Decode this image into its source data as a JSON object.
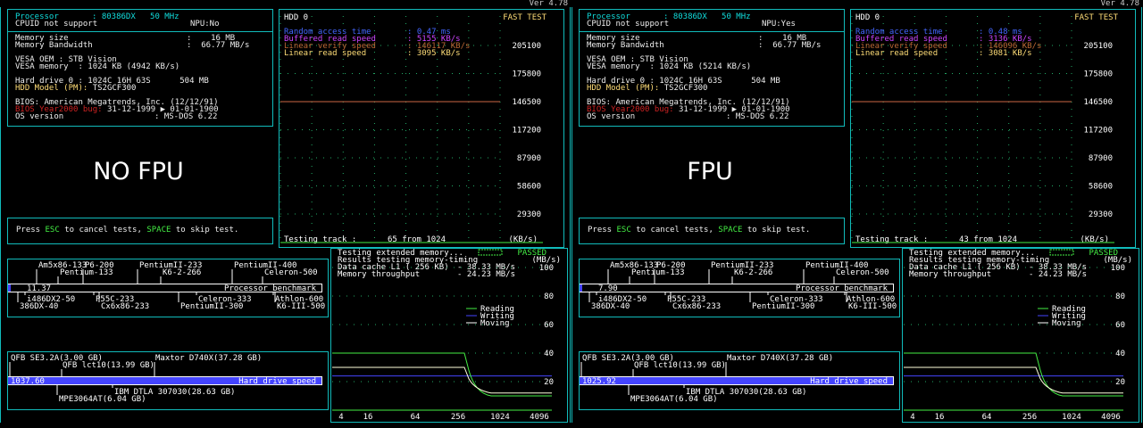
{
  "version": "Ver 4.78",
  "screens": [
    {
      "cpu": {
        "processor_label": "Processor",
        "processor_value": ": 80386DX   50 MHz",
        "cpuid": "CPUID not support",
        "npu": "NPU:No",
        "mem_size_label": "Memory size",
        "mem_size_value": ":    16 MB",
        "mem_bw_label": "Memory Bandwidth",
        "mem_bw_value": ":  66.77 MB/s",
        "vesa_oem": "VESA OEM : STB Vision",
        "vesa_mem": "VESA memory  : 1024 KB (4942 KB/s)",
        "hdd_label": "Hard drive 0 :",
        "hdd_value": "1024C 16H 63S      504 MB",
        "hdd_model_label": "HDD Model (PM):",
        "hdd_model_value": "TS2GCF300",
        "bios": "BIOS: American Megatrends, Inc. (12/12/91)",
        "y2k_label": "BIOS Year2000 bug:",
        "y2k_value": "31-12-1999 ▶ 01-01-1900",
        "os_label": "OS version",
        "os_value": ": MS-DOS 6.22"
      },
      "big_label": "NO FPU",
      "esc_prefix": "Press ",
      "esc_key": "ESC",
      "esc_mid": " to cancel tests, ",
      "space_key": "SPACE",
      "esc_suffix": " to skip test.",
      "hdd": {
        "title": "HDD 0",
        "mode": "FAST TEST",
        "random_label": "Random access time",
        "random_value": ": 0.47 ms",
        "buffered_label": "Buffered read speed",
        "buffered_value": ": 5155 KB/s",
        "verify_label": "Linear verify speed",
        "verify_value": ": 146117 KB/s",
        "linear_label": "Linear read speed",
        "linear_value": ": 3095 KB/s",
        "track_label": "Testing track :",
        "track_value": "65 from    1024",
        "unit": "(KB/s)",
        "y_ticks": [
          "205100",
          "175800",
          "146500",
          "117200",
          "87900",
          "58600",
          "29300"
        ]
      },
      "cpu_bench": {
        "labels": [
          {
            "text": "Am5x86-133",
            "x": 33,
            "y": 4,
            "above": true
          },
          {
            "text": "P6-200",
            "x": 85,
            "y": 4,
            "above": true
          },
          {
            "text": "PentiumII-233",
            "x": 146,
            "y": 4,
            "above": true
          },
          {
            "text": "PentiumII-400",
            "x": 252,
            "y": 4,
            "above": true
          },
          {
            "text": "Pentium-133",
            "x": 57,
            "y": 12,
            "above": true
          },
          {
            "text": "K6-2-266",
            "x": 172,
            "y": 12,
            "above": true
          },
          {
            "text": "Celeron-500",
            "x": 286,
            "y": 12,
            "above": true
          },
          {
            "text": "i486DX2-50",
            "x": 20,
            "y": 42,
            "above": false
          },
          {
            "text": "P55C-233",
            "x": 97,
            "y": 42,
            "above": false
          },
          {
            "text": "Celeron-333",
            "x": 212,
            "y": 42,
            "above": false
          },
          {
            "text": "Athlon-600",
            "x": 298,
            "y": 42,
            "above": false
          },
          {
            "text": "386DX-40",
            "x": 12,
            "y": 50,
            "above": false
          },
          {
            "text": "Cx6x86-233",
            "x": 103,
            "y": 50,
            "above": false
          },
          {
            "text": "PentiumII-300",
            "x": 192,
            "y": 50,
            "above": false
          },
          {
            "text": "K6-III-500",
            "x": 300,
            "y": 50,
            "above": false
          }
        ],
        "value": "11.37",
        "title": "Processor benchmark",
        "fill_fraction": 0.008
      },
      "hdd_bench": {
        "top_labels": [
          {
            "text": "QFB SE3.2A(3.00 GB)",
            "x": 2,
            "y": 4
          },
          {
            "text": "Maxtor D740X(37.28 GB)",
            "x": 164,
            "y": 4
          },
          {
            "text": "QFB lct10(13.99 GB)",
            "x": 60,
            "y": 12
          }
        ],
        "bottom_labels": [
          {
            "text": "IBM DTLA 307030(28.63 GB)",
            "x": 118,
            "y": 42
          },
          {
            "text": "MPE3064AT(6.04 GB)",
            "x": 56,
            "y": 50
          }
        ],
        "value": "1037.60",
        "title": "Hard drive speed",
        "fill_fraction": 1.0
      },
      "mem": {
        "line1": "Testing extended memory...",
        "status": "PASSED",
        "line2": "Results testing memory-timing",
        "unit": "(MB/s)",
        "l1_label": "Data cache L1 ( 256 KB)",
        "l1_value": "-   38.33 MB/s",
        "tp_label": "Memory throughput",
        "tp_value": "-   24.23 MB/s",
        "legend": [
          "Reading",
          "Writing",
          "Moving"
        ],
        "y_ticks": [
          "100",
          "80",
          "60",
          "40",
          "20"
        ],
        "x_ticks": [
          "4",
          "16",
          "64",
          "256",
          "1024",
          "4096"
        ]
      }
    },
    {
      "cpu": {
        "processor_label": "Processor",
        "processor_value": ": 80386DX   50 MHz",
        "cpuid": "CPUID not support",
        "npu": "NPU:Yes",
        "mem_size_label": "Memory size",
        "mem_size_value": ":    16 MB",
        "mem_bw_label": "Memory Bandwidth",
        "mem_bw_value": ":  66.77 MB/s",
        "vesa_oem": "VESA OEM : STB Vision",
        "vesa_mem": "VESA memory  : 1024 KB (5214 KB/s)",
        "hdd_label": "Hard drive 0 :",
        "hdd_value": "1024C 16H 63S      504 MB",
        "hdd_model_label": "HDD Model (PM):",
        "hdd_model_value": "TS2GCF300",
        "bios": "BIOS: American Megatrends, Inc. (12/12/91)",
        "y2k_label": "BIOS Year2000 bug:",
        "y2k_value": "31-12-1999 ▶ 01-01-1900",
        "os_label": "OS version",
        "os_value": ": MS-DOS 6.22"
      },
      "big_label": "FPU",
      "esc_prefix": "Press ",
      "esc_key": "ESC",
      "esc_mid": " to cancel tests, ",
      "space_key": "SPACE",
      "esc_suffix": " to skip test.",
      "hdd": {
        "title": "HDD 0",
        "mode": "FAST TEST",
        "random_label": "Random access time",
        "random_value": ": 0.48 ms",
        "buffered_label": "Buffered read speed",
        "buffered_value": ": 3136 KB/s",
        "verify_label": "Linear verify speed",
        "verify_value": ": 146096 KB/s",
        "linear_label": "Linear read speed",
        "linear_value": ": 3081 KB/s",
        "track_label": "Testing track :",
        "track_value": "43 from    1024",
        "unit": "(KB/s)",
        "y_ticks": [
          "205100",
          "175800",
          "146500",
          "117200",
          "87900",
          "58600",
          "29300"
        ]
      },
      "cpu_bench": {
        "labels": [
          {
            "text": "Am5x86-133",
            "x": 33,
            "y": 4,
            "above": true
          },
          {
            "text": "P6-200",
            "x": 85,
            "y": 4,
            "above": true
          },
          {
            "text": "PentiumII-233",
            "x": 146,
            "y": 4,
            "above": true
          },
          {
            "text": "PentiumII-400",
            "x": 252,
            "y": 4,
            "above": true
          },
          {
            "text": "Pentium-133",
            "x": 57,
            "y": 12,
            "above": true
          },
          {
            "text": "K6-2-266",
            "x": 172,
            "y": 12,
            "above": true
          },
          {
            "text": "Celeron-500",
            "x": 286,
            "y": 12,
            "above": true
          },
          {
            "text": "i486DX2-50",
            "x": 20,
            "y": 42,
            "above": false
          },
          {
            "text": "P55C-233",
            "x": 97,
            "y": 42,
            "above": false
          },
          {
            "text": "Celeron-333",
            "x": 212,
            "y": 42,
            "above": false
          },
          {
            "text": "Athlon-600",
            "x": 298,
            "y": 42,
            "above": false
          },
          {
            "text": "386DX-40",
            "x": 12,
            "y": 50,
            "above": false
          },
          {
            "text": "Cx6x86-233",
            "x": 103,
            "y": 50,
            "above": false
          },
          {
            "text": "PentiumII-300",
            "x": 192,
            "y": 50,
            "above": false
          },
          {
            "text": "K6-III-500",
            "x": 300,
            "y": 50,
            "above": false
          }
        ],
        "value": "7.90",
        "title": "Processor benchmark",
        "fill_fraction": 0.006
      },
      "hdd_bench": {
        "top_labels": [
          {
            "text": "QFB SE3.2A(3.00 GB)",
            "x": 2,
            "y": 4
          },
          {
            "text": "Maxtor D740X(37.28 GB)",
            "x": 164,
            "y": 4
          },
          {
            "text": "QFB lct10(13.99 GB)",
            "x": 60,
            "y": 12
          }
        ],
        "bottom_labels": [
          {
            "text": "IBM DTLA 307030(28.63 GB)",
            "x": 118,
            "y": 42
          },
          {
            "text": "MPE3064AT(6.04 GB)",
            "x": 56,
            "y": 50
          }
        ],
        "value": "1025.92",
        "title": "Hard drive speed",
        "fill_fraction": 1.0
      },
      "mem": {
        "line1": "Testing extended memory...",
        "status": "PASSED",
        "line2": "Results testing memory-timing",
        "unit": "(MB/s)",
        "l1_label": "Data cache L1 ( 256 KB)",
        "l1_value": "-   38.33 MB/s",
        "tp_label": "Memory throughput",
        "tp_value": "-   24.23 MB/s",
        "legend": [
          "Reading",
          "Writing",
          "Moving"
        ],
        "y_ticks": [
          "100",
          "80",
          "60",
          "40",
          "20"
        ],
        "x_ticks": [
          "4",
          "16",
          "64",
          "256",
          "1024",
          "4096"
        ]
      }
    }
  ]
}
